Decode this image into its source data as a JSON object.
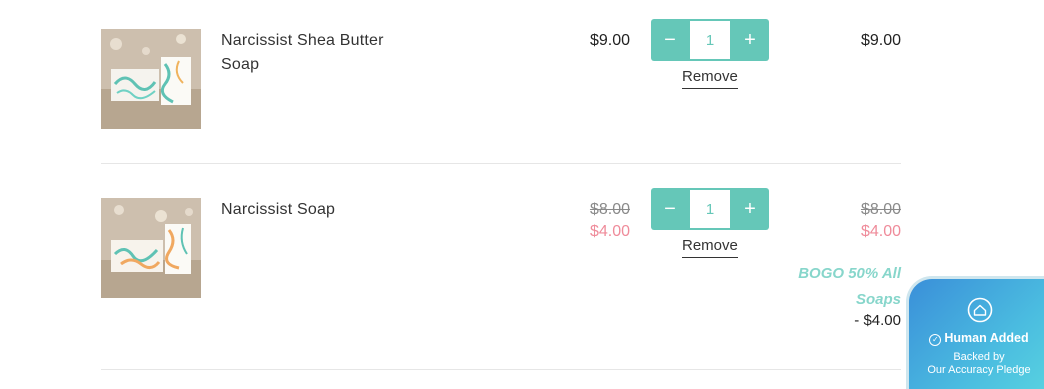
{
  "cart": {
    "items": [
      {
        "name": "Narcissist Shea Butter Soap",
        "price": "$9.00",
        "quantity": "1",
        "total": "$9.00",
        "remove_label": "Remove"
      },
      {
        "name": "Narcissist Soap",
        "original_price": "$8.00",
        "sale_price": "$4.00",
        "quantity": "1",
        "original_total": "$8.00",
        "sale_total": "$4.00",
        "remove_label": "Remove",
        "promo_name": "BOGO 50% All Soaps",
        "promo_amount": "- $4.00"
      }
    ],
    "qty_minus_symbol": "−",
    "qty_plus_symbol": "+"
  },
  "badge": {
    "title": "Human Added",
    "line1": "Backed by",
    "line2": "Our Accuracy Pledge"
  },
  "colors": {
    "accent": "#65c7b8",
    "sale": "#ef8b9a",
    "promo": "#87d6cb",
    "badge_start": "#3a8fd9",
    "badge_end": "#5ad6e0"
  }
}
